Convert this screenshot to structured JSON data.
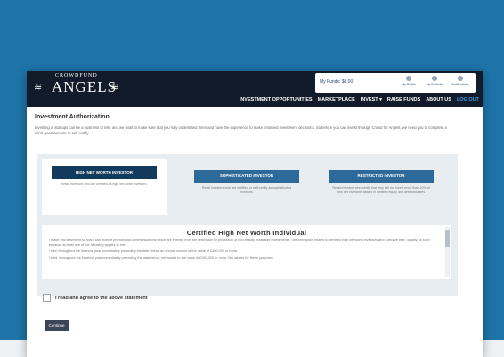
{
  "header": {
    "logo_small": "CROWDFUND",
    "logo_big": "ANGELS",
    "funds_label": "My Funds: $0.00",
    "account_links": [
      {
        "label": "My Profile",
        "icon": "user-icon"
      },
      {
        "label": "My Portfolio",
        "icon": "briefcase-icon"
      },
      {
        "label": "Notifications",
        "icon": "bell-icon"
      }
    ],
    "nav": [
      {
        "label": "INVESTMENT OPPORTUNITIES"
      },
      {
        "label": "MARKETPLACE"
      },
      {
        "label": "INVEST ▾"
      },
      {
        "label": "RAISE FUNDS"
      },
      {
        "label": "ABOUT US"
      },
      {
        "label": "LOG OUT"
      }
    ]
  },
  "page": {
    "title": "Investment Authorization",
    "intro": "Investing in startups can be a business of risk, and we want to make sure that you fully understand them and have the experience to make informed investment decisions. So before you can invest through Crowd for Angels, we need you to complete a short questionnaire or self certify."
  },
  "investor_types": [
    {
      "label": "HIGH NET WORTH INVESTOR",
      "desc": "Retail investors who are certified as high net worth investors."
    },
    {
      "label": "SOPHISTICATED INVESTOR",
      "desc": "Retail investors who are certified or self-certify as sophisticated investors."
    },
    {
      "label": "RESTRICTED INVESTOR",
      "desc": "Retail investors who certify that they will not invest more than 10% of their net investible assets in unlisted equity and debt securities."
    }
  ],
  "certificate": {
    "title": "Certified High Net Worth Individual",
    "para1": "I make this statement so that I can receive promotional communications which are exempt from the restriction on promotion of non-readily realisable investments. The exemption relates to certified high net worth investors and I declare that I qualify as such because at least one of the following applies to me:",
    "para2": "I had, throughout the financial year immediately preceding the date below, an annual income to the value of £100,000 or more.",
    "para3": "I held, throughout the financial year immediately preceding the date below, net assets to the value of £250,000 or more. Net assets for these purposes"
  },
  "agree_label": "I read and agree to the above statement",
  "continue_label": "Continue"
}
